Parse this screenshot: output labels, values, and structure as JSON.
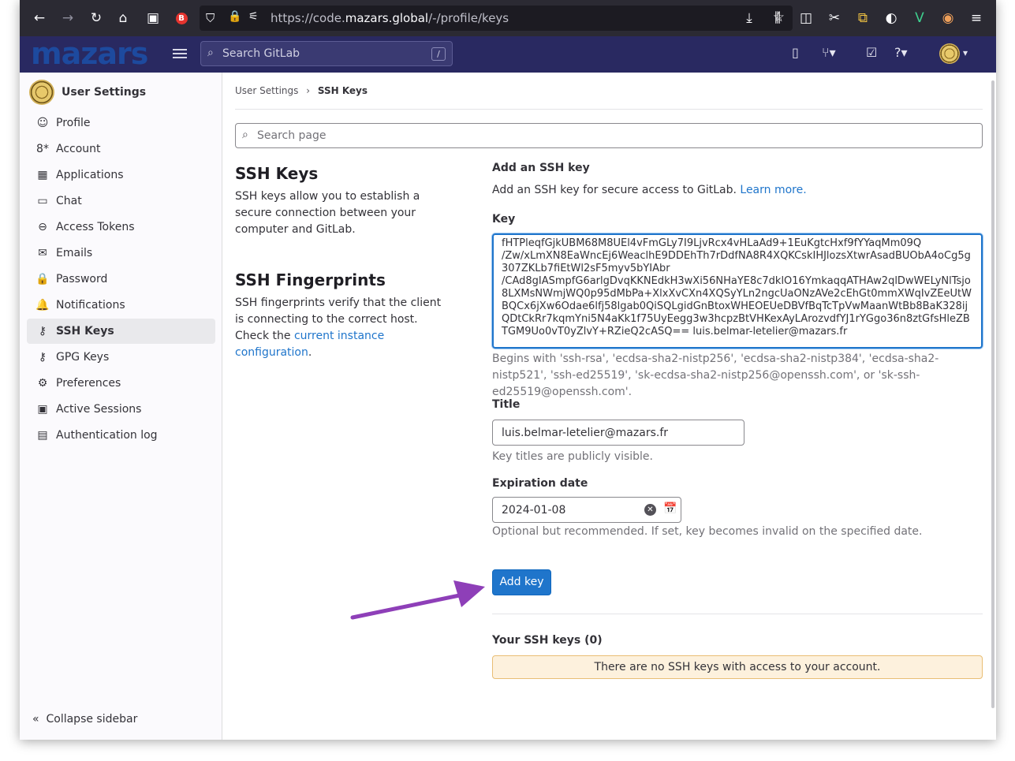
{
  "browser": {
    "url_prefix": "https://code.",
    "url_domain": "mazars.global",
    "url_path": "/-/profile/keys"
  },
  "header": {
    "logo": "mazars",
    "search_placeholder": "Search GitLab",
    "search_shortcut": "/"
  },
  "sidebar": {
    "title": "User Settings",
    "items": [
      {
        "label": "Profile",
        "icon": "profile-icon",
        "glyph": "☺"
      },
      {
        "label": "Account",
        "icon": "account-icon",
        "glyph": "8*"
      },
      {
        "label": "Applications",
        "icon": "applications-icon",
        "glyph": "▦"
      },
      {
        "label": "Chat",
        "icon": "chat-icon",
        "glyph": "▭"
      },
      {
        "label": "Access Tokens",
        "icon": "token-icon",
        "glyph": "⊖"
      },
      {
        "label": "Emails",
        "icon": "email-icon",
        "glyph": "✉"
      },
      {
        "label": "Password",
        "icon": "lock-icon",
        "glyph": "🔒"
      },
      {
        "label": "Notifications",
        "icon": "bell-icon",
        "glyph": "🔔"
      },
      {
        "label": "SSH Keys",
        "icon": "key-icon",
        "glyph": "⚷"
      },
      {
        "label": "GPG Keys",
        "icon": "key-icon",
        "glyph": "⚷"
      },
      {
        "label": "Preferences",
        "icon": "preferences-icon",
        "glyph": "⚙"
      },
      {
        "label": "Active Sessions",
        "icon": "monitor-icon",
        "glyph": "▣"
      },
      {
        "label": "Authentication log",
        "icon": "log-icon",
        "glyph": "▤"
      }
    ],
    "active_index": 8,
    "collapse_label": "Collapse sidebar"
  },
  "breadcrumb": {
    "parent": "User Settings",
    "separator": "›",
    "current": "SSH Keys"
  },
  "search_page_placeholder": "Search page",
  "ssh_section": {
    "title": "SSH Keys",
    "description": "SSH keys allow you to establish a secure connection between your computer and GitLab."
  },
  "fingerprints_section": {
    "title": "SSH Fingerprints",
    "description": "SSH fingerprints verify that the client is connecting to the correct host. Check the ",
    "link": "current instance configuration",
    "suffix": "."
  },
  "form": {
    "heading": "Add an SSH key",
    "intro": "Add an SSH key for secure access to GitLab. ",
    "learn_more": "Learn more.",
    "key_label": "Key",
    "key_value": "fHTPleqfGjkUBM68M8UEl4vFmGLy7I9LjvRcx4vHLaAd9+1EuKgtcHxf9fYYaqMm09Q\n/Zw/xLmXN8EaWncEj6WeaclhE9DDEhTh7rDdfNA8R4XQKCskIHJlozsXtwrAsadBUObA4oCg5g307ZKLb7fiEtWl2sF5myv5bYIAbr\n/CAd8gIASmpfG6arlgDvqKKNEdkH3wXi56NHaYE8c7dklO16YmkaqqATHAw2qlDwWELyNlTsjo8LXMsNWmjWQ0p95dMbPa+XlxXvCXn4XQSyYLn2ngcUaONzAVe2cEhGt0mmXWqIvZEeUtWBQCx6jXw6Odae6lfj58lgab0QiSQLgidGnBtoxWHEOEUeDBVfBqTcTpVwMaanWtBb8BaK328ijQDtCkRr7kqmYni5N4aKk1f75UyEegg3w3hcpzBtVHKexAyLArozvdfYJ1rYGgo36n8ztGfsHleZBTGM9Uo0vT0yZlvY+RZieQ2cASQ== luis.belmar-letelier@mazars.fr",
    "key_help": "Begins with 'ssh-rsa', 'ecdsa-sha2-nistp256', 'ecdsa-sha2-nistp384', 'ecdsa-sha2-nistp521', 'ssh-ed25519', 'sk-ecdsa-sha2-nistp256@openssh.com', or 'sk-ssh-ed25519@openssh.com'.",
    "title_label": "Title",
    "title_value": "luis.belmar-letelier@mazars.fr",
    "title_help": "Key titles are publicly visible.",
    "expiration_label": "Expiration date",
    "expiration_value": "2024-01-08",
    "expiration_help": "Optional but recommended. If set, key becomes invalid on the specified date.",
    "submit_label": "Add key"
  },
  "your_keys": {
    "heading": "Your SSH keys (0)",
    "empty_message": "There are no SSH keys with access to your account."
  },
  "colors": {
    "header_bg": "#292961",
    "primary": "#1f75cb",
    "annotation_arrow": "#8e3fb8"
  }
}
